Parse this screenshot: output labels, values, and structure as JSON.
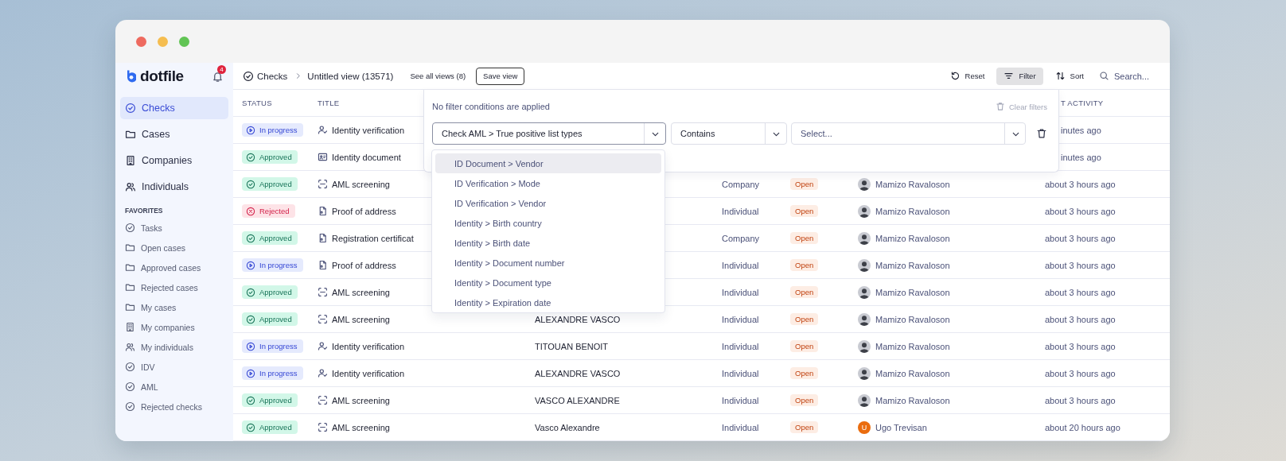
{
  "window": {
    "controls": [
      {
        "color": "#ee6a5f"
      },
      {
        "color": "#f5bd4f"
      },
      {
        "color": "#61c454"
      }
    ]
  },
  "sidebar": {
    "logo": "dotfile",
    "notifications": "4",
    "nav": [
      {
        "label": "Checks",
        "kind": "check",
        "selected": true
      },
      {
        "label": "Cases",
        "kind": "folder",
        "selected": false
      },
      {
        "label": "Companies",
        "kind": "building",
        "selected": false
      },
      {
        "label": "Individuals",
        "kind": "people",
        "selected": false
      }
    ],
    "favorites_heading": "FAVORITES",
    "favorites": [
      {
        "label": "Tasks",
        "kind": "check",
        "selected": false
      },
      {
        "label": "Open cases",
        "kind": "folder",
        "selected": false
      },
      {
        "label": "Approved cases",
        "kind": "folder",
        "selected": false
      },
      {
        "label": "Rejected cases",
        "kind": "folder",
        "selected": false
      },
      {
        "label": "My cases",
        "kind": "folder",
        "selected": false
      },
      {
        "label": "My companies",
        "kind": "building",
        "selected": false
      },
      {
        "label": "My individuals",
        "kind": "people",
        "selected": false
      },
      {
        "label": "IDV",
        "kind": "check",
        "selected": false
      },
      {
        "label": "AML",
        "kind": "check",
        "selected": false
      },
      {
        "label": "Rejected checks",
        "kind": "check",
        "selected": false
      }
    ]
  },
  "topbar": {
    "breadcrumb": [
      "Checks",
      "Untitled view (13571)"
    ],
    "views_link": "See all views (8)",
    "save_button": "Save view",
    "actions": [
      {
        "label": "Reset",
        "kind": "reset",
        "active": false
      },
      {
        "label": "Filter",
        "kind": "filter",
        "active": true
      },
      {
        "label": "Sort",
        "kind": "sort",
        "active": false
      }
    ],
    "search": {
      "placeholder": "Search..."
    }
  },
  "table": {
    "columns": {
      "status": "STATUS",
      "title": "TITLE",
      "activity": "T ACTIVITY"
    },
    "rows": [
      {
        "status": {
          "label": "In progress",
          "kind": "in_progress"
        },
        "title": {
          "label": "Identity verification",
          "kind": "person"
        },
        "activity": "inutes ago"
      },
      {
        "status": {
          "label": "Approved",
          "kind": "approved"
        },
        "title": {
          "label": "Identity document",
          "kind": "idcard"
        },
        "activity": "inutes ago"
      },
      {
        "status": {
          "label": "Approved",
          "kind": "approved"
        },
        "title": {
          "label": "AML screening",
          "kind": "scan"
        },
        "entity_type": "Company",
        "case_status": "Open",
        "assignee": {
          "name": "Mamizo Ravaloson",
          "kind": "photo"
        },
        "activity": "about 3 hours ago"
      },
      {
        "status": {
          "label": "Rejected",
          "kind": "rejected"
        },
        "title": {
          "label": "Proof of address",
          "kind": "document"
        },
        "entity_type": "Individual",
        "case_status": "Open",
        "assignee": {
          "name": "Mamizo Ravaloson",
          "kind": "photo"
        },
        "activity": "about 3 hours ago"
      },
      {
        "status": {
          "label": "Approved",
          "kind": "approved"
        },
        "title": {
          "label": "Registration certificat",
          "kind": "document"
        },
        "entity_type": "Company",
        "case_status": "Open",
        "assignee": {
          "name": "Mamizo Ravaloson",
          "kind": "photo"
        },
        "activity": "about 3 hours ago"
      },
      {
        "status": {
          "label": "In progress",
          "kind": "in_progress"
        },
        "title": {
          "label": "Proof of address",
          "kind": "document"
        },
        "entity_type": "Individual",
        "case_status": "Open",
        "assignee": {
          "name": "Mamizo Ravaloson",
          "kind": "photo"
        },
        "activity": "about 3 hours ago"
      },
      {
        "status": {
          "label": "Approved",
          "kind": "approved"
        },
        "title": {
          "label": "AML screening",
          "kind": "scan"
        },
        "entity_type": "Individual",
        "case_status": "Open",
        "assignee": {
          "name": "Mamizo Ravaloson",
          "kind": "photo"
        },
        "activity": "about 3 hours ago"
      },
      {
        "status": {
          "label": "Approved",
          "kind": "approved"
        },
        "title": {
          "label": "AML screening",
          "kind": "scan"
        },
        "name": "ALEXANDRE VASCO",
        "entity_type": "Individual",
        "case_status": "Open",
        "assignee": {
          "name": "Mamizo Ravaloson",
          "kind": "photo"
        },
        "activity": "about 3 hours ago"
      },
      {
        "status": {
          "label": "In progress",
          "kind": "in_progress"
        },
        "title": {
          "label": "Identity verification",
          "kind": "person"
        },
        "name": "TITOUAN BENOIT",
        "entity_type": "Individual",
        "case_status": "Open",
        "assignee": {
          "name": "Mamizo Ravaloson",
          "kind": "photo"
        },
        "activity": "about 3 hours ago"
      },
      {
        "status": {
          "label": "In progress",
          "kind": "in_progress"
        },
        "title": {
          "label": "Identity verification",
          "kind": "person"
        },
        "name": "ALEXANDRE VASCO",
        "entity_type": "Individual",
        "case_status": "Open",
        "assignee": {
          "name": "Mamizo Ravaloson",
          "kind": "photo"
        },
        "activity": "about 3 hours ago"
      },
      {
        "status": {
          "label": "Approved",
          "kind": "approved"
        },
        "title": {
          "label": "AML screening",
          "kind": "scan"
        },
        "name": "VASCO ALEXANDRE",
        "entity_type": "Individual",
        "case_status": "Open",
        "assignee": {
          "name": "Mamizo Ravaloson",
          "kind": "photo"
        },
        "activity": "about 3 hours ago"
      },
      {
        "status": {
          "label": "Approved",
          "kind": "approved"
        },
        "title": {
          "label": "AML screening",
          "kind": "scan"
        },
        "name": "Vasco Alexandre",
        "entity_type": "Individual",
        "case_status": "Open",
        "assignee": {
          "name": "Ugo Trevisan",
          "kind": "initial",
          "initial": "U",
          "color": "#ea6c0e"
        },
        "activity": "about 20 hours ago"
      }
    ]
  },
  "filter": {
    "empty_message": "No filter conditions are applied",
    "clear_button": {
      "label": "Clear filters",
      "disabled": true
    },
    "field": {
      "value": "Check AML > True positive list types"
    },
    "operator": {
      "value": "Contains"
    },
    "value_select": {
      "placeholder": "Select..."
    },
    "options": [
      {
        "label": "ID Document > Vendor",
        "selected": true
      },
      {
        "label": "ID Verification > Mode",
        "selected": false
      },
      {
        "label": "ID Verification > Vendor",
        "selected": false
      },
      {
        "label": "Identity > Birth country",
        "selected": false
      },
      {
        "label": "Identity > Birth date",
        "selected": false
      },
      {
        "label": "Identity > Document number",
        "selected": false
      },
      {
        "label": "Identity > Document type",
        "selected": false
      },
      {
        "label": "Identity > Expiration date",
        "selected": false
      }
    ]
  }
}
